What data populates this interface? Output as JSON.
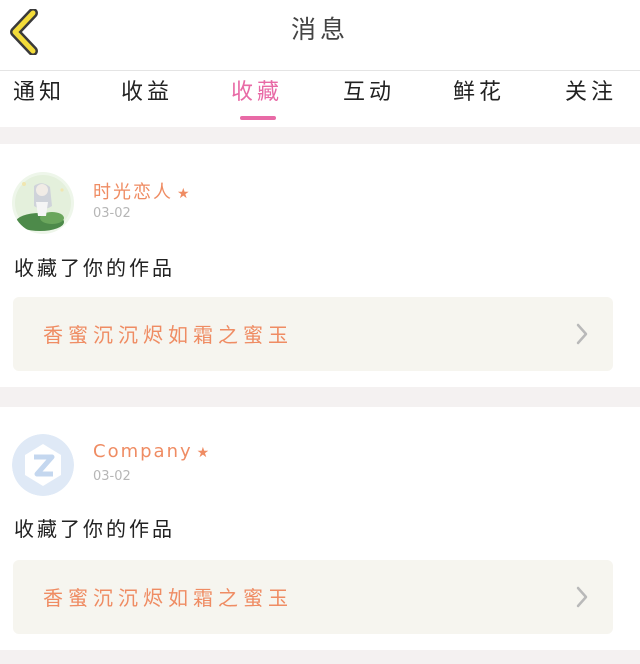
{
  "header": {
    "title": "消息",
    "back_icon": "chevron-left-icon",
    "accent": "#f3dc3a"
  },
  "tabs": [
    {
      "label": "通知",
      "active": false
    },
    {
      "label": "收益",
      "active": false
    },
    {
      "label": "收藏",
      "active": true
    },
    {
      "label": "互动",
      "active": false
    },
    {
      "label": "鲜花",
      "active": false
    },
    {
      "label": "关注",
      "active": false
    }
  ],
  "colors": {
    "active_tab": "#e86aa6",
    "username": "#ef8c63",
    "work_box": "#f6f5ef"
  },
  "messages": [
    {
      "username": "时光恋人",
      "star": "★",
      "date": "03-02",
      "action": "收藏了你的作品",
      "work_title": "香蜜沉沉烬如霜之蜜玉"
    },
    {
      "username": "Company",
      "star": "★",
      "date": "03-02",
      "action": "收藏了你的作品",
      "work_title": "香蜜沉沉烬如霜之蜜玉"
    }
  ]
}
